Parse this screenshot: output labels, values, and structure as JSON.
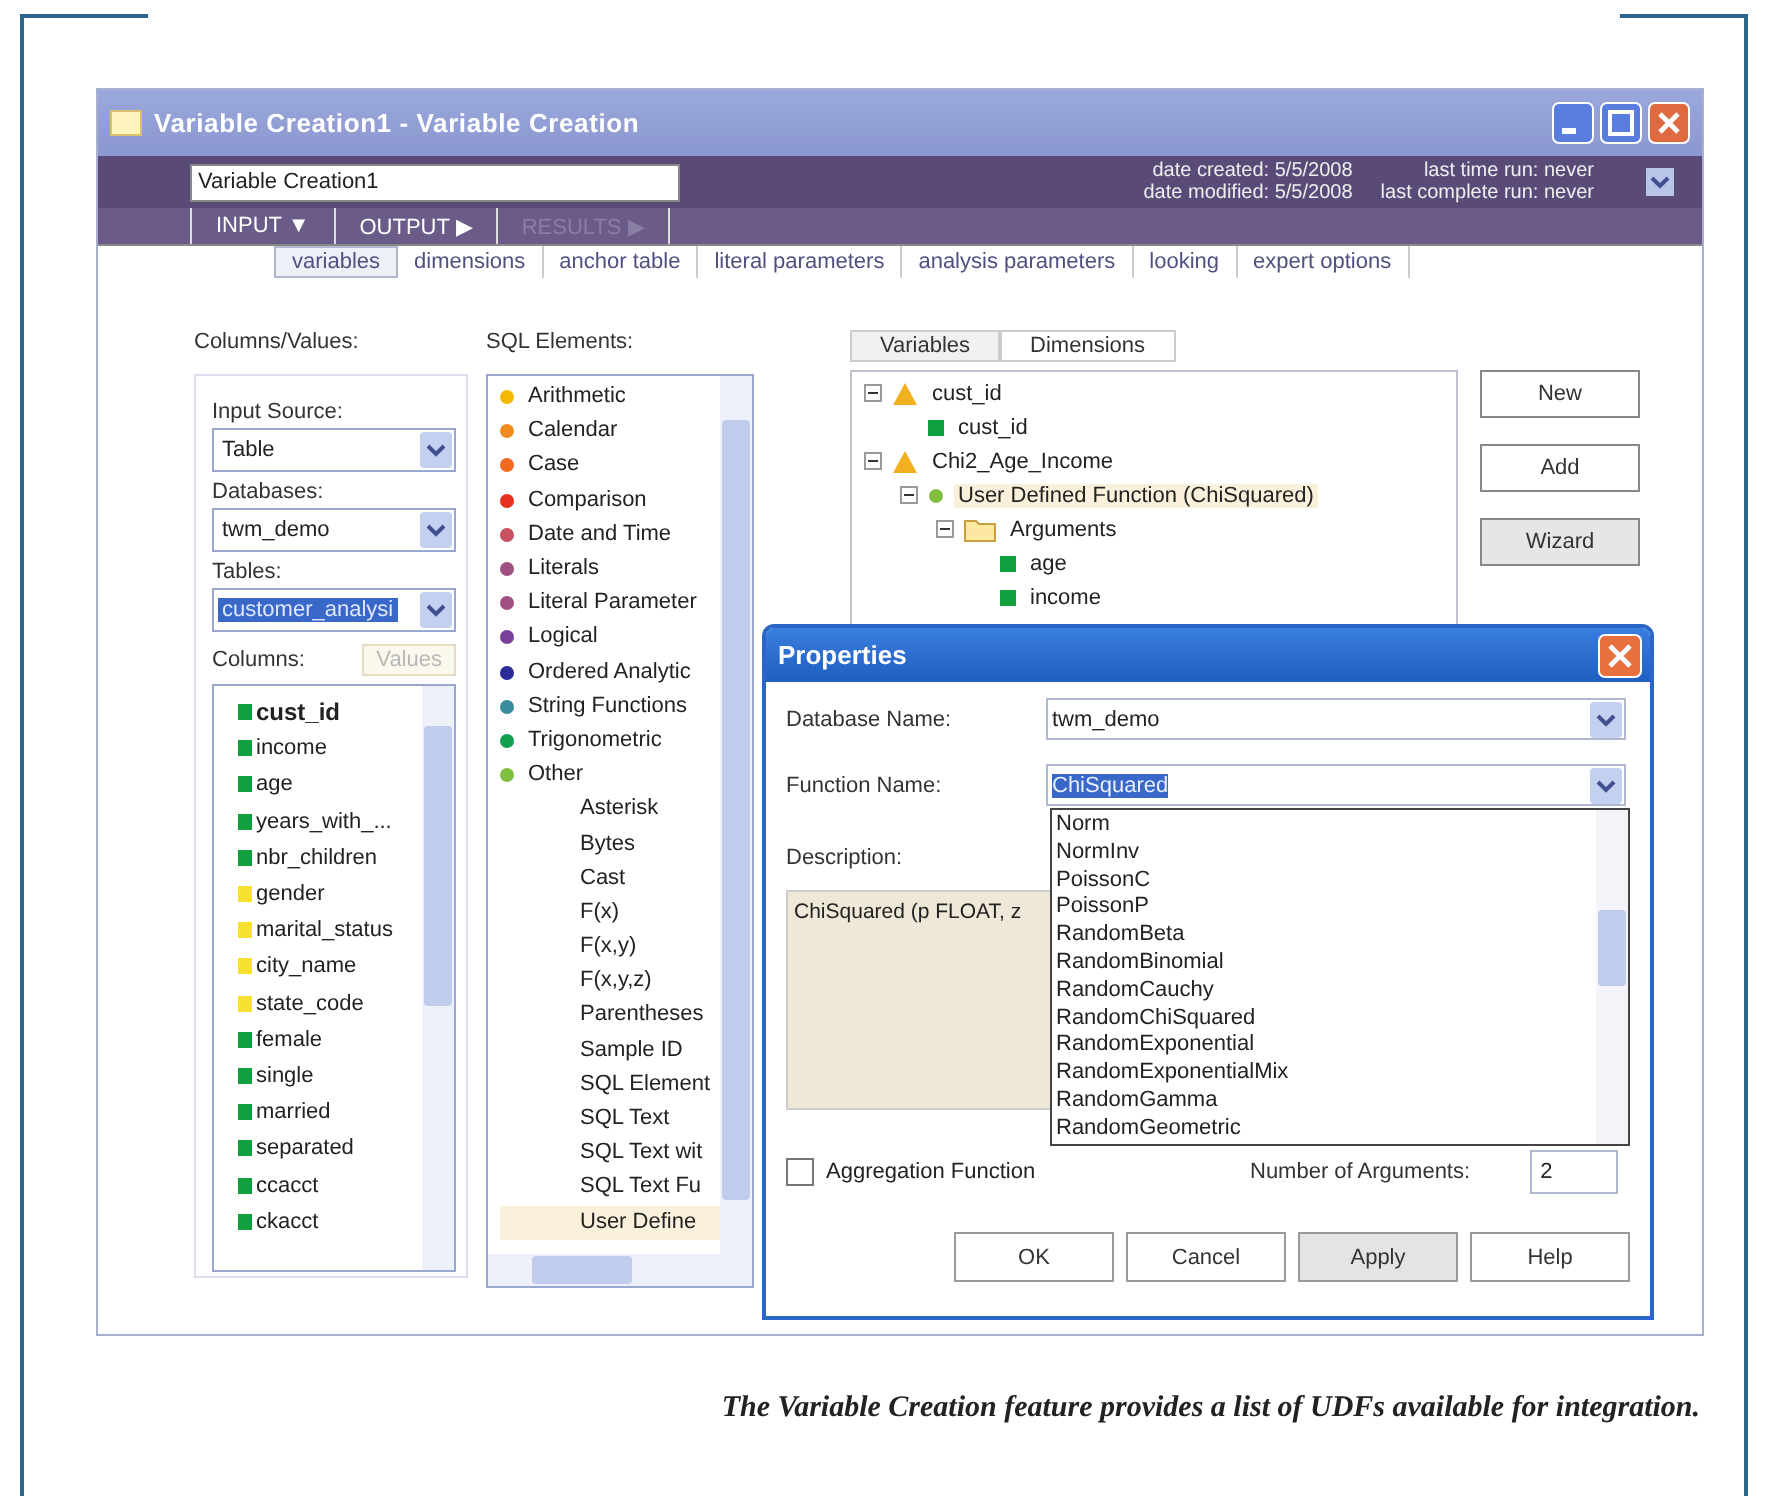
{
  "window": {
    "title": "Variable Creation1 - Variable Creation"
  },
  "header": {
    "name_value": "Variable Creation1",
    "date_created": "date created: 5/5/2008",
    "date_modified": "date modified: 5/5/2008",
    "last_run": "last time run: never",
    "last_complete_run": "last complete run: never"
  },
  "nav": [
    {
      "label": "INPUT",
      "arrow": "▼",
      "disabled": false
    },
    {
      "label": "OUTPUT",
      "arrow": "▶",
      "disabled": false
    },
    {
      "label": "RESULTS",
      "arrow": "▶",
      "disabled": true
    }
  ],
  "subtabs": [
    {
      "label": "variables",
      "selected": true
    },
    {
      "label": "dimensions",
      "selected": false
    },
    {
      "label": "anchor table",
      "selected": false
    },
    {
      "label": "literal parameters",
      "selected": false
    },
    {
      "label": "analysis parameters",
      "selected": false
    },
    {
      "label": "looking",
      "selected": false
    },
    {
      "label": "expert options",
      "selected": false
    }
  ],
  "columns_values": {
    "heading": "Columns/Values:",
    "input_source": {
      "label": "Input Source:",
      "value": "Table",
      "selected": false
    },
    "databases": {
      "label": "Databases:",
      "value": "twm_demo",
      "selected": false
    },
    "tables": {
      "label": "Tables:",
      "value": "customer_analysi",
      "selected": true
    },
    "columns_label": "Columns:",
    "values_button": {
      "label": "Values",
      "disabled": true
    },
    "columns": [
      {
        "name": "cust_id",
        "selected": true,
        "color": "#10a040"
      },
      {
        "name": "income",
        "selected": false,
        "color": "#10a040"
      },
      {
        "name": "age",
        "selected": false,
        "color": "#10a040"
      },
      {
        "name": "years_with_...",
        "selected": false,
        "color": "#10a040"
      },
      {
        "name": "nbr_children",
        "selected": false,
        "color": "#10a040"
      },
      {
        "name": "gender",
        "selected": false,
        "color": "#f8e030"
      },
      {
        "name": "marital_status",
        "selected": false,
        "color": "#f8e030"
      },
      {
        "name": "city_name",
        "selected": false,
        "color": "#f8e030"
      },
      {
        "name": "state_code",
        "selected": false,
        "color": "#f8e030"
      },
      {
        "name": "female",
        "selected": false,
        "color": "#10a040"
      },
      {
        "name": "single",
        "selected": false,
        "color": "#10a040"
      },
      {
        "name": "married",
        "selected": false,
        "color": "#10a040"
      },
      {
        "name": "separated",
        "selected": false,
        "color": "#10a040"
      },
      {
        "name": "ccacct",
        "selected": false,
        "color": "#10a040"
      },
      {
        "name": "ckacct",
        "selected": false,
        "color": "#10a040"
      }
    ]
  },
  "sql_elements": {
    "heading": "SQL Elements:",
    "items": [
      {
        "label": "Arithmetic",
        "color": "#f5b800"
      },
      {
        "label": "Calendar",
        "color": "#f08a20"
      },
      {
        "label": "Case",
        "color": "#f06a20"
      },
      {
        "label": "Comparison",
        "color": "#e83020"
      },
      {
        "label": "Date and Time",
        "color": "#c85060"
      },
      {
        "label": "Literals",
        "color": "#a05080"
      },
      {
        "label": "Literal Parameter",
        "color": "#a05080"
      },
      {
        "label": "Logical",
        "color": "#7a3f98"
      },
      {
        "label": "Ordered Analytic",
        "color": "#2a2a9a"
      },
      {
        "label": "String Functions",
        "color": "#3a8aa0"
      },
      {
        "label": "Trigonometric",
        "color": "#10a050"
      },
      {
        "label": "Other",
        "color": "#80c040",
        "children": [
          {
            "label": "Asterisk",
            "selected": false
          },
          {
            "label": "Bytes",
            "selected": false
          },
          {
            "label": "Cast",
            "selected": false
          },
          {
            "label": "F(x)",
            "selected": false
          },
          {
            "label": "F(x,y)",
            "selected": false
          },
          {
            "label": "F(x,y,z)",
            "selected": false
          },
          {
            "label": "Parentheses",
            "selected": false
          },
          {
            "label": "Sample ID",
            "selected": false
          },
          {
            "label": "SQL Element",
            "selected": false
          },
          {
            "label": "SQL Text",
            "selected": false
          },
          {
            "label": "SQL Text wit",
            "selected": false
          },
          {
            "label": "SQL Text Fu",
            "selected": false
          },
          {
            "label": "User Define",
            "selected": true
          }
        ]
      }
    ]
  },
  "variable_tabs": [
    {
      "label": "Variables",
      "selected": true
    },
    {
      "label": "Dimensions",
      "selected": false
    }
  ],
  "tree": [
    {
      "label": "cust_id",
      "kind": "variable",
      "expanded": true,
      "selected": false,
      "children": [
        {
          "label": "cust_id",
          "kind": "column",
          "selected": false
        }
      ]
    },
    {
      "label": "Chi2_Age_Income",
      "kind": "variable",
      "expanded": true,
      "selected": false,
      "children": [
        {
          "label": "User Defined Function (ChiSquared)",
          "kind": "function",
          "expanded": true,
          "selected": true,
          "children": [
            {
              "label": "Arguments",
              "kind": "folder",
              "expanded": true,
              "selected": false,
              "children": [
                {
                  "label": "age",
                  "kind": "column",
                  "selected": false
                },
                {
                  "label": "income",
                  "kind": "column",
                  "selected": false
                }
              ]
            }
          ]
        }
      ]
    }
  ],
  "buttons": [
    {
      "label": "New",
      "pressed": false
    },
    {
      "label": "Add",
      "pressed": false
    },
    {
      "label": "Wizard",
      "pressed": true
    }
  ],
  "properties_dialog": {
    "title": "Properties",
    "database_name": {
      "label": "Database Name:",
      "value": "twm_demo"
    },
    "function_name": {
      "label": "Function Name:",
      "value": "ChiSquared"
    },
    "function_options": [
      "Norm",
      "NormInv",
      "PoissonC",
      "PoissonP",
      "RandomBeta",
      "RandomBinomial",
      "RandomCauchy",
      "RandomChiSquared",
      "RandomExponential",
      "RandomExponentialMix",
      "RandomGamma",
      "RandomGeometric"
    ],
    "description_label": "Description:",
    "description": "ChiSquared (p FLOAT, z",
    "aggregation": {
      "label": "Aggregation Function",
      "checked": false
    },
    "arguments": {
      "label": "Number of Arguments:",
      "value": "2"
    },
    "buttons": [
      {
        "label": "OK",
        "pressed": false
      },
      {
        "label": "Cancel",
        "pressed": false
      },
      {
        "label": "Apply",
        "pressed": true
      },
      {
        "label": "Help",
        "pressed": false
      }
    ]
  },
  "caption": "The Variable Creation feature provides a list of UDFs available for integration."
}
